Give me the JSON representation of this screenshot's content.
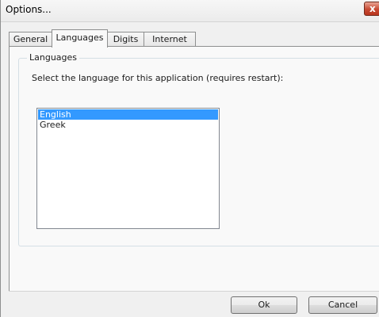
{
  "window": {
    "title": "Options...",
    "close_glyph": "x"
  },
  "tabs": [
    {
      "label": "General",
      "active": false
    },
    {
      "label": "Languages",
      "active": true
    },
    {
      "label": "Digits",
      "active": false
    },
    {
      "label": "Internet",
      "active": false
    }
  ],
  "languages_group": {
    "legend": "Languages",
    "instruction": "Select the language for this application (requires restart):",
    "items": [
      {
        "label": "English",
        "selected": true
      },
      {
        "label": "Greek",
        "selected": false
      }
    ]
  },
  "buttons": {
    "ok_label": "Ok",
    "cancel_label": "Cancel"
  },
  "colors": {
    "selection": "#3399ff",
    "close_button": "#c74a33"
  },
  "icons": {
    "close": "close-icon"
  }
}
